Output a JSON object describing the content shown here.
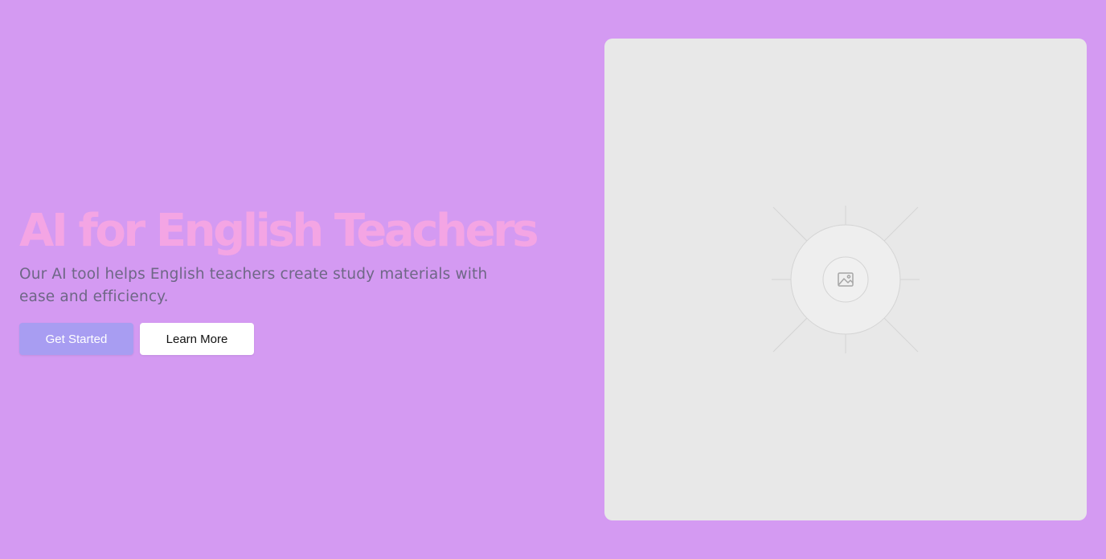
{
  "colors": {
    "background": "#d49af2",
    "title": "#f4a5e4",
    "subtitle": "#6e6786",
    "primary_button_bg": "#a89df2",
    "primary_button_text": "#ffffff",
    "secondary_button_bg": "#ffffff",
    "secondary_button_text": "#111111",
    "card_bg": "#e8e8e8",
    "placeholder_line": "#d4d4d4",
    "placeholder_icon": "#a6a6a6"
  },
  "hero": {
    "title": "AI for English Teachers",
    "subtitle": "Our AI tool helps English teachers create study materials with ease and efficiency.",
    "primary_button_label": "Get Started",
    "secondary_button_label": "Learn More"
  },
  "media": {
    "icon": "image-icon"
  }
}
